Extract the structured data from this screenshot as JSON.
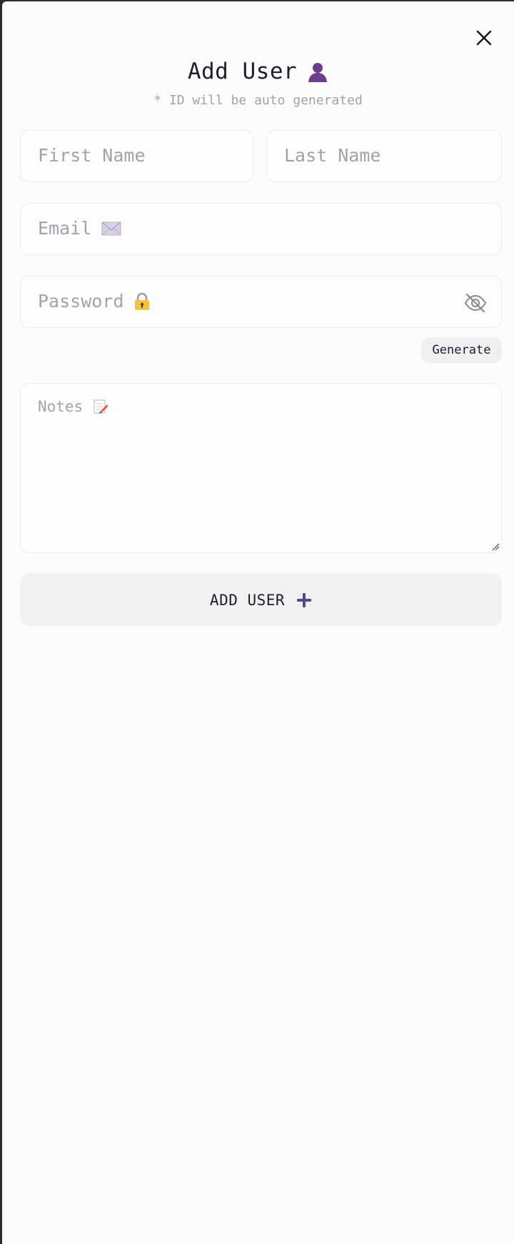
{
  "header": {
    "title": "Add User",
    "subtitle": "* ID will be auto generated",
    "close_icon": "close-icon",
    "title_icon": "user-icon"
  },
  "form": {
    "first_name": {
      "placeholder": "First Name",
      "value": ""
    },
    "last_name": {
      "placeholder": "Last Name",
      "value": ""
    },
    "email": {
      "placeholder": "Email",
      "value": "",
      "icon": "envelope-icon"
    },
    "password": {
      "placeholder": "Password",
      "value": "",
      "icon": "lock-icon",
      "toggle_icon": "eye-off-icon"
    },
    "generate_label": "Generate",
    "notes": {
      "placeholder": "Notes",
      "value": "",
      "icon": "memo-icon"
    },
    "submit_label": "ADD USER",
    "submit_icon": "plus-icon"
  },
  "colors": {
    "accent": "#5b4591",
    "text": "#1e1e2e",
    "muted": "#a3a1ad",
    "field_border": "#ececef",
    "button_bg": "#f1f1f1"
  }
}
